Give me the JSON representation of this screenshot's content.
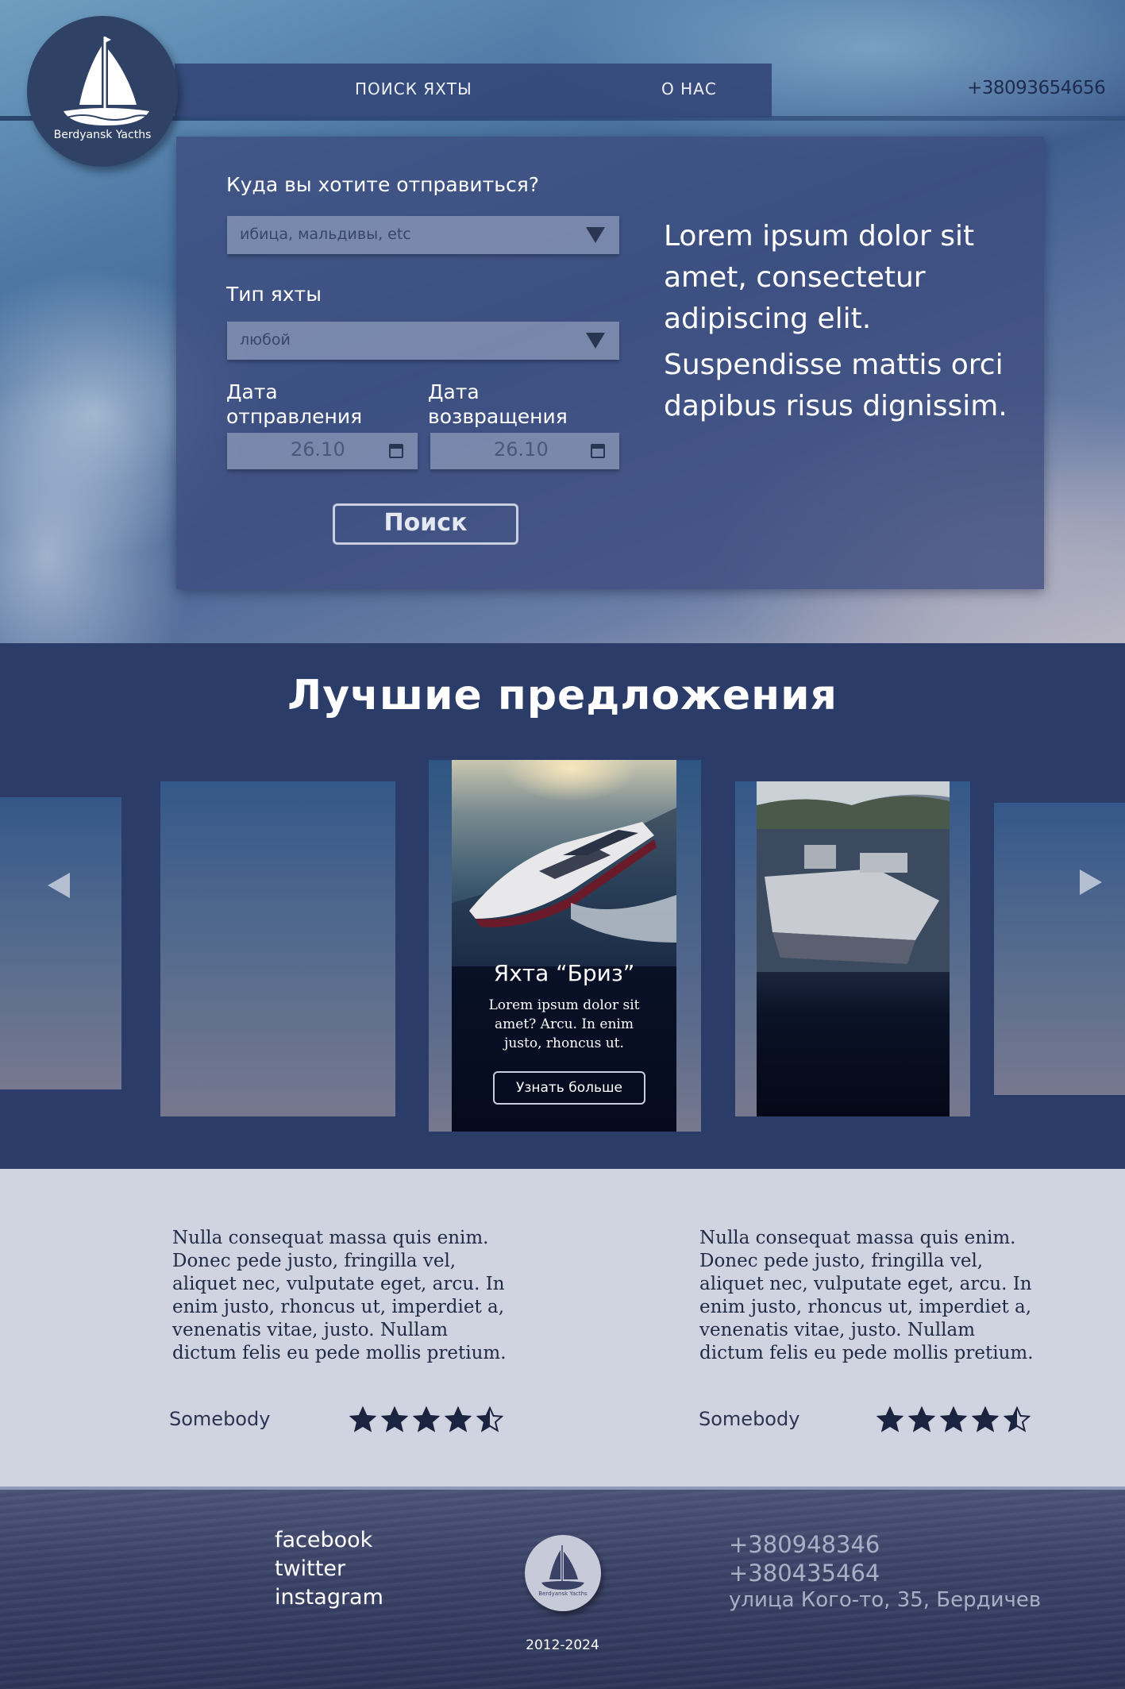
{
  "header": {
    "logo_text": "Berdyansk Yacths",
    "nav": [
      {
        "label": "ПОИСК ЯХТЫ"
      },
      {
        "label": "О НАС"
      }
    ],
    "phone": "+38093654656"
  },
  "search": {
    "destination_label": "Куда вы хотите отправиться?",
    "destination_value": "ибица, мальдивы, etc",
    "yacht_type_label": "Тип яхты",
    "yacht_type_value": "любой",
    "departure_label": "Дата отправления",
    "departure_value": "26.10",
    "return_label": "Дата возвращения",
    "return_value": "26.10",
    "button_label": "Поиск"
  },
  "hero_text": {
    "p1": "Lorem ipsum dolor sit amet, consectetur adipiscing elit.",
    "p2": "Suspendisse mattis orci dapibus risus dignissim."
  },
  "offers": {
    "title": "Лучшие предложения",
    "featured": {
      "title": "Яхта “Бриз”",
      "description": "Lorem ipsum dolor sit amet? Arcu. In enim justo, rhoncus ut.",
      "button_label": "Узнать больше"
    }
  },
  "reviews": [
    {
      "text": "Nulla consequat massa quis enim. Donec pede justo, fringilla vel, aliquet nec, vulputate eget, arcu. In enim justo, rhoncus ut, imperdiet a, venenatis vitae, justo. Nullam dictum felis eu pede mollis pretium.",
      "author": "Somebody",
      "rating": 4.5
    },
    {
      "text": "Nulla consequat massa quis enim. Donec pede justo, fringilla vel, aliquet nec, vulputate eget, arcu. In enim justo, rhoncus ut, imperdiet a, venenatis vitae, justo. Nullam dictum felis eu pede mollis pretium.",
      "author": "Somebody",
      "rating": 4.5
    }
  ],
  "footer": {
    "social": [
      "facebook",
      "twitter",
      "instagram"
    ],
    "logo_text": "Berdyansk Yacths",
    "years": "2012-2024",
    "phones": [
      "+380948346",
      "+380435464"
    ],
    "address": "улица Кого-то, 35, Бердичев"
  },
  "icons": {
    "logo": "sailboat-icon",
    "dropdown": "triangle-down-icon",
    "calendar": "calendar-icon",
    "prev": "arrow-left-icon",
    "next": "arrow-right-icon",
    "star": "star-icon"
  },
  "colors": {
    "primary": "#2b3c68",
    "panel": "#3c4b7d",
    "light": "#d0d4e0",
    "star": "#1a2440"
  }
}
